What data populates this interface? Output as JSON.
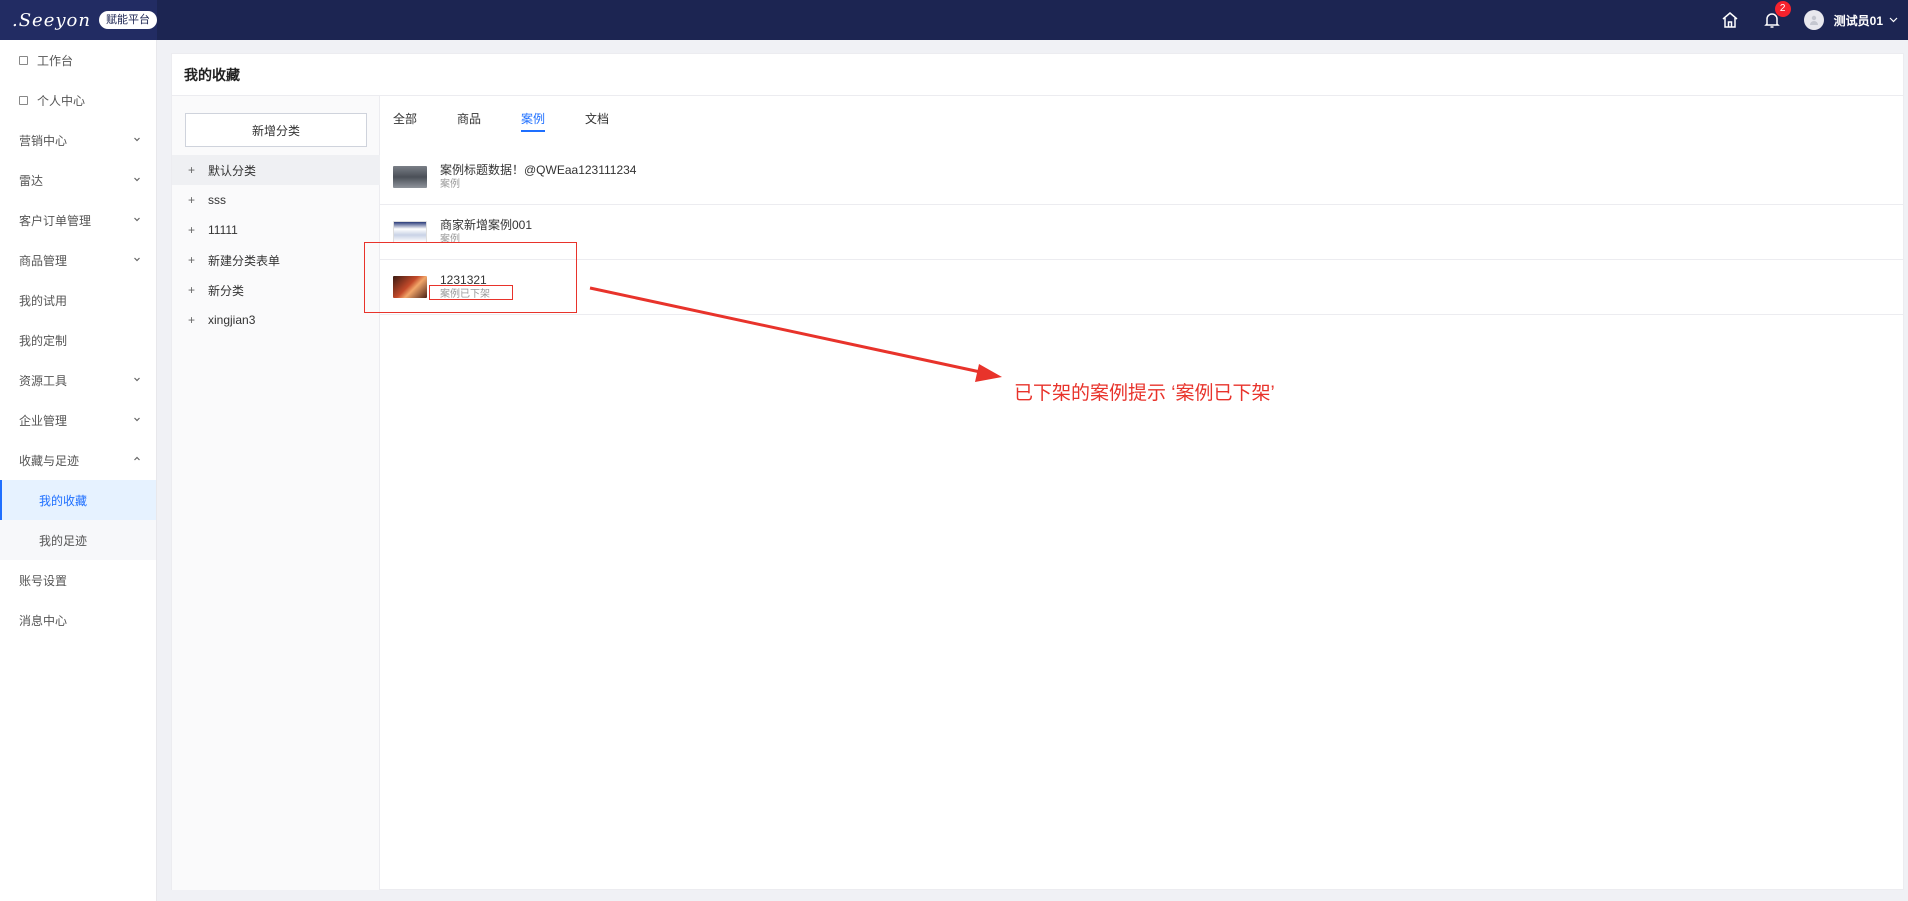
{
  "header": {
    "logo_text": ".Seeyon",
    "logo_tag": "赋能平台",
    "notification_count": "2",
    "user_name": "测试员01"
  },
  "sidebar": {
    "items": [
      {
        "label": "工作台",
        "icon": "square-icon"
      },
      {
        "label": "个人中心",
        "icon": "square-icon"
      },
      {
        "label": "营销中心",
        "expandable": true
      },
      {
        "label": "雷达",
        "expandable": true
      },
      {
        "label": "客户订单管理",
        "expandable": true
      },
      {
        "label": "商品管理",
        "expandable": true
      },
      {
        "label": "我的试用"
      },
      {
        "label": "我的定制"
      },
      {
        "label": "资源工具",
        "expandable": true
      },
      {
        "label": "企业管理",
        "expandable": true
      },
      {
        "label": "收藏与足迹",
        "expanded": true
      }
    ],
    "sub_items": [
      {
        "label": "我的收藏",
        "active": true
      },
      {
        "label": "我的足迹"
      }
    ],
    "bottom_items": [
      {
        "label": "账号设置"
      },
      {
        "label": "消息中心"
      }
    ]
  },
  "page": {
    "title": "我的收藏",
    "add_category_label": "新增分类",
    "categories": [
      {
        "label": "默认分类",
        "selected": true
      },
      {
        "label": "sss"
      },
      {
        "label": "11111"
      },
      {
        "label": "新建分类表单"
      },
      {
        "label": "新分类"
      },
      {
        "label": "xingjian3"
      }
    ],
    "tabs": [
      {
        "label": "全部"
      },
      {
        "label": "商品"
      },
      {
        "label": "案例",
        "active": true
      },
      {
        "label": "文档"
      }
    ],
    "favorites": [
      {
        "title": "案例标题数据！@QWEaa123111234",
        "type": "案例"
      },
      {
        "title": "商家新增案例001",
        "type": "案例"
      },
      {
        "title": "1231321",
        "type": "案例已下架"
      }
    ]
  },
  "annotation": {
    "text": "已下架的案例提示 ‘案例已下架’",
    "color": "#e8332b"
  },
  "colors": {
    "topbar": "#1c2552",
    "accent": "#1e6fff"
  }
}
